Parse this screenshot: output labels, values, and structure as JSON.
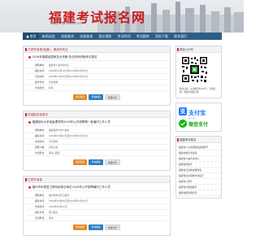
{
  "header": {
    "logo_title": "福建考试报名网",
    "logo_url": "http://fjksbm.com"
  },
  "nav": [
    "首页",
    "新闻动态",
    "成绩查询",
    "成绩查询",
    "报名通知",
    "考试时间",
    "考试题库",
    "资料下载",
    "联系我们"
  ],
  "cards": [
    {
      "head": "已发布消息(免费)，请及时关注",
      "title": "2026年福建省国家执业资格·执业药师资格考试报名",
      "rows": [
        {
          "label": "通知单位：",
          "value": "福建省人事考试中心"
        },
        {
          "label": "报名时间：",
          "value": "2026年03月10日至2026年03月18日"
        },
        {
          "label": "考试时间：",
          "value": "2026年10月18日至2026年10月19日"
        },
        {
          "label": "报考条件：",
          "value": "详见简章"
        },
        {
          "label": "考试形式：",
          "value": "机考"
        }
      ],
      "buttons": [
        "填写报名",
        "查询成绩",
        "收藏本页"
      ]
    },
    {
      "head": "热招报名信息中",
      "title": "福建医科大学省级理学院2026年公开招聘第一批编内工作人员",
      "rows": [
        {
          "label": "通知单位：",
          "value": "福建医科大学人事处"
        },
        {
          "label": "报名时间：",
          "value": "2026年03月02日至2026年03月16日"
        },
        {
          "label": "考试时间：",
          "value": "另行通知"
        },
        {
          "label": "招聘人数：",
          "value": "详见公告"
        },
        {
          "label": "考试形式：",
          "value": "笔试+面试"
        }
      ],
      "buttons": [
        "填写报名",
        "查询成绩",
        "收藏本页"
      ]
    },
    {
      "head": "已发布消息",
      "title": "福州市永泰县卫健系统事业单位2026年公开招聘编内工作人员",
      "rows": [
        {
          "label": "通知单位：",
          "value": "福州市永泰县卫健局"
        },
        {
          "label": "报名时间：",
          "value": "2026年03月05日至2026年03月12日"
        },
        {
          "label": "考试时间：",
          "value": "2026年04月12日"
        },
        {
          "label": "报名方式：",
          "value": "网上报名"
        },
        {
          "label": "考试形式：",
          "value": "笔试"
        }
      ],
      "buttons": [
        "填写报名",
        "查询成绩",
        "收藏本页"
      ]
    }
  ],
  "sidebar": {
    "qr_head": "微信公众号",
    "qr_note": "微信扫描，关注我们的公众号，考试提醒、成绩查询更方便",
    "alipay": "支付宝",
    "alipay_sub": "ALIPAY",
    "wechat": "微信支付",
    "links_head": "福建考试报名",
    "links": [
      "福建省人力资源和社会保障厅",
      "福建省教育考试院",
      "福建省人事考试中心",
      "福建省财政厅",
      "福建省卫生健康委员会",
      "福建省住房和城乡建设厅",
      "福建省公安厅",
      "福建省交通运输厅",
      "福建省国家税务局"
    ]
  },
  "colors": {
    "nav": "#2e5e86",
    "accent": "#c91d1d",
    "orange_btn": "#e6882a",
    "blue_btn": "#2d7dc3"
  }
}
